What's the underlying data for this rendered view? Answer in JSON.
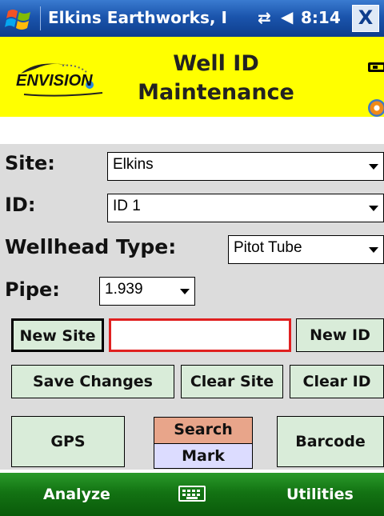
{
  "titlebar": {
    "title": "Elkins Earthworks, I",
    "time": "8:14",
    "close_label": "X",
    "connectivity_icon": "connectivity-icon",
    "volume_icon": "speaker-icon"
  },
  "header": {
    "logo_text": "ENVISION",
    "title_line1": "Well ID",
    "title_line2": "Maintenance",
    "colors": {
      "header_bg": "#ffff00",
      "titlebar_bg": "#1b55ad",
      "menubar_bg": "#137313"
    }
  },
  "form": {
    "site_label": "Site:",
    "site_value": "Elkins",
    "id_label": "ID:",
    "id_value": "ID 1",
    "wellhead_label": "Wellhead Type:",
    "wellhead_value": "Pitot Tube",
    "pipe_label": "Pipe:",
    "pipe_value": "1.939",
    "new_id_input_value": ""
  },
  "buttons": {
    "new_site": "New Site",
    "new_id": "New ID",
    "save_changes": "Save Changes",
    "clear_site": "Clear Site",
    "clear_id": "Clear ID",
    "gps": "GPS",
    "search": "Search",
    "mark": "Mark",
    "barcode": "Barcode"
  },
  "menubar": {
    "left": "Analyze",
    "right": "Utilities",
    "center_icon": "keyboard-icon"
  }
}
